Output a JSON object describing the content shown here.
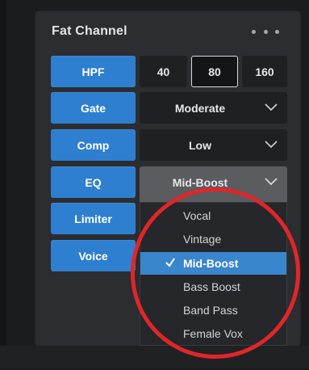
{
  "panel": {
    "title": "Fat Channel"
  },
  "rows": {
    "hpf": {
      "label": "HPF",
      "options": [
        "40",
        "80",
        "160"
      ],
      "selected": "80"
    },
    "gate": {
      "label": "Gate",
      "value": "Moderate"
    },
    "comp": {
      "label": "Comp",
      "value": "Low"
    },
    "eq": {
      "label": "EQ",
      "value": "Mid-Boost"
    },
    "limiter": {
      "label": "Limiter"
    },
    "voice": {
      "label": "Voice"
    }
  },
  "eq_menu": {
    "items": [
      "Vocal",
      "Vintage",
      "Mid-Boost",
      "Bass Boost",
      "Band Pass",
      "Female Vox"
    ],
    "selected": "Mid-Boost"
  },
  "icons": {
    "more": "more-horizontal-icon",
    "dropdown": "chevron-down-icon",
    "check": "checkmark-icon"
  },
  "colors": {
    "accent_blue": "#2f7fd0",
    "menu_selected": "#3a86cc",
    "annotation_ring": "#e0262a",
    "panel_bg": "#2c2d30"
  }
}
